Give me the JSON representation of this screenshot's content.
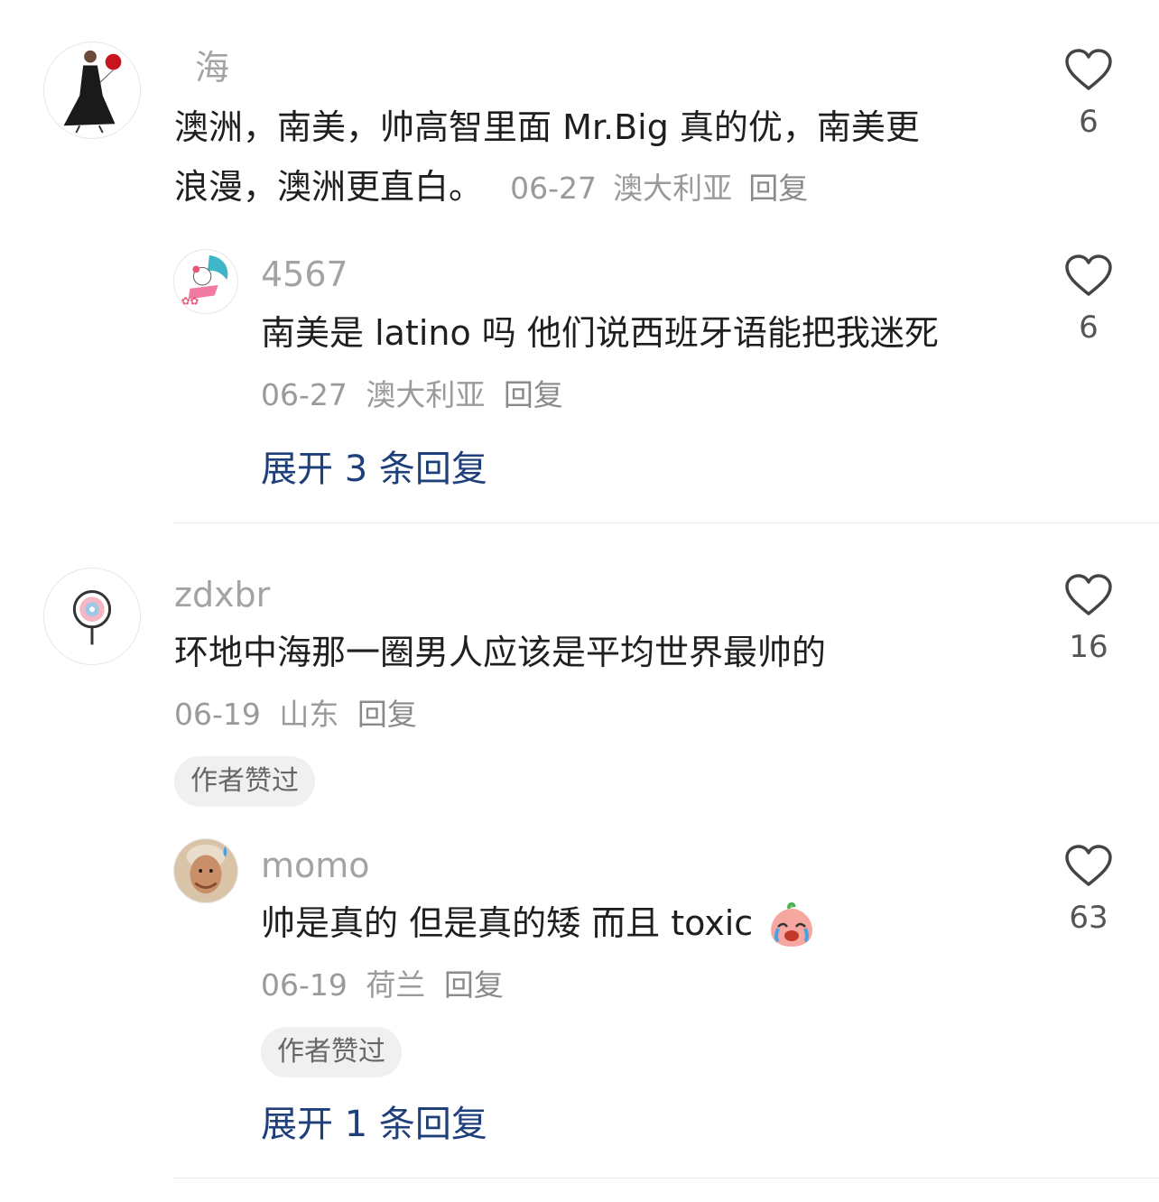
{
  "comments": [
    {
      "username": "海",
      "avatar_icon": "woman-with-heart-balloon-avatar",
      "text_line1": "澳洲，南美，帅高智里面 Mr.Big 真的优，南美更",
      "text_line2": "浪漫，澳洲更直白。",
      "date": "06-27",
      "location": "澳大利亚",
      "reply_label": "回复",
      "likes": "6",
      "replies": [
        {
          "username": "4567",
          "avatar_icon": "hello-kitty-surfing-avatar",
          "text": "南美是 latino 吗 他们说西班牙语能把我迷死",
          "date": "06-27",
          "location": "澳大利亚",
          "reply_label": "回复",
          "likes": "6"
        }
      ],
      "expand_label": "展开 3 条回复"
    },
    {
      "username": "zdxbr",
      "avatar_icon": "lollipop-avatar",
      "text": "环地中海那一圈男人应该是平均世界最帅的",
      "date": "06-19",
      "location": "山东",
      "reply_label": "回复",
      "likes": "16",
      "badge": "作者赞过",
      "replies": [
        {
          "username": "momo",
          "avatar_icon": "person-photo-avatar",
          "text": "帅是真的 但是真的矮 而且 toxic",
          "emoji": "crying-peach-emoji",
          "date": "06-19",
          "location": "荷兰",
          "reply_label": "回复",
          "likes": "63",
          "badge": "作者赞过"
        }
      ],
      "expand_label": "展开 1 条回复"
    }
  ],
  "colors": {
    "username": "#a3a3a3",
    "text": "#1f1f1f",
    "meta": "#9a9a9a",
    "expand_link": "#1e3f7a",
    "badge_bg": "#f0f0f0"
  }
}
